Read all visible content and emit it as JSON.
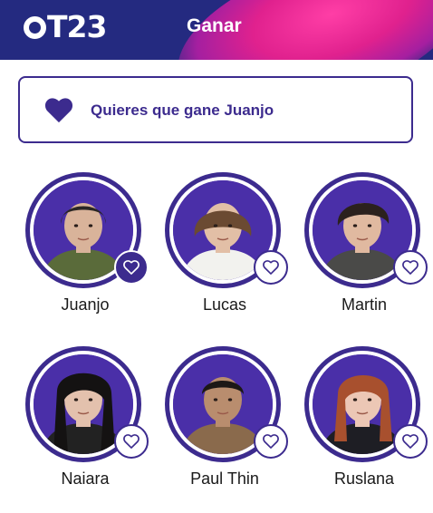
{
  "header": {
    "logo_text": "OT23",
    "title": "Ganar"
  },
  "vote_status": {
    "text": "Quieres que gane Juanjo",
    "icon": "heart-icon"
  },
  "contestants": [
    {
      "name": "Juanjo",
      "favorited": true,
      "hair": "#2a2624",
      "skin": "#d9b39a",
      "shirt": "#5a6b3a"
    },
    {
      "name": "Lucas",
      "favorited": false,
      "hair": "#6b4a32",
      "skin": "#e2bfa6",
      "shirt": "#f2f2ee"
    },
    {
      "name": "Martin",
      "favorited": false,
      "hair": "#2b211d",
      "skin": "#e0b9a0",
      "shirt": "#4a4a48"
    },
    {
      "name": "Naiara",
      "favorited": false,
      "hair": "#141212",
      "skin": "#e3c1ad",
      "shirt": "#222222"
    },
    {
      "name": "Paul Thin",
      "favorited": false,
      "hair": "#1c1816",
      "skin": "#b98d6e",
      "shirt": "#8a6a4c"
    },
    {
      "name": "Ruslana",
      "favorited": false,
      "hair": "#a8502e",
      "skin": "#ecc7b5",
      "shirt": "#1e1e24"
    }
  ],
  "colors": {
    "header_bg": "#242a80",
    "accent": "#3c2b8e",
    "photo_bg": "#4a2fa8"
  }
}
